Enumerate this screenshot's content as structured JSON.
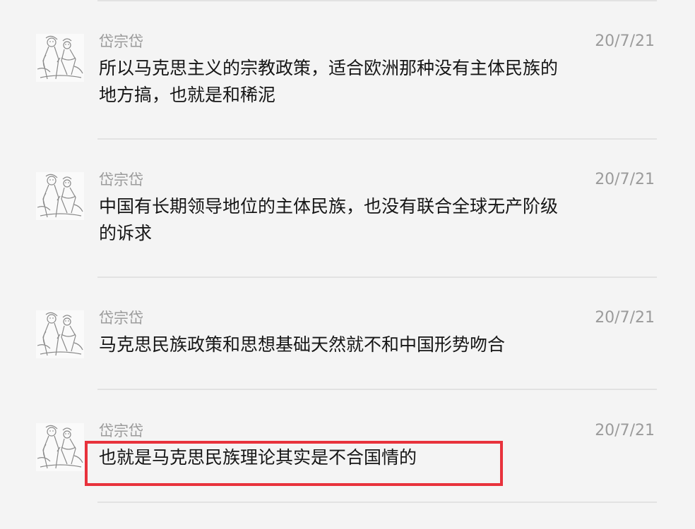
{
  "messages": [
    {
      "sender": "岱宗岱",
      "date": "20/7/21",
      "text": "所以马克思主义的宗教政策，适合欧洲那种没有主体民族的地方搞，也就是和稀泥",
      "avatar_icon": "sketch-figures-avatar-icon"
    },
    {
      "sender": "岱宗岱",
      "date": "20/7/21",
      "text": "中国有长期领导地位的主体民族，也没有联合全球无产阶级的诉求",
      "avatar_icon": "sketch-figures-avatar-icon"
    },
    {
      "sender": "岱宗岱",
      "date": "20/7/21",
      "text": "马克思民族政策和思想基础天然就不和中国形势吻合",
      "avatar_icon": "sketch-figures-avatar-icon"
    },
    {
      "sender": "岱宗岱",
      "date": "20/7/21",
      "text": "也就是马克思民族理论其实是不合国情的",
      "avatar_icon": "sketch-figures-avatar-icon",
      "highlighted": true
    }
  ],
  "colors": {
    "background": "#f4f4f4",
    "meta_text": "#9b9b9b",
    "body_text": "#161616",
    "divider": "#e2e2e2",
    "highlight": "#e8323c"
  }
}
